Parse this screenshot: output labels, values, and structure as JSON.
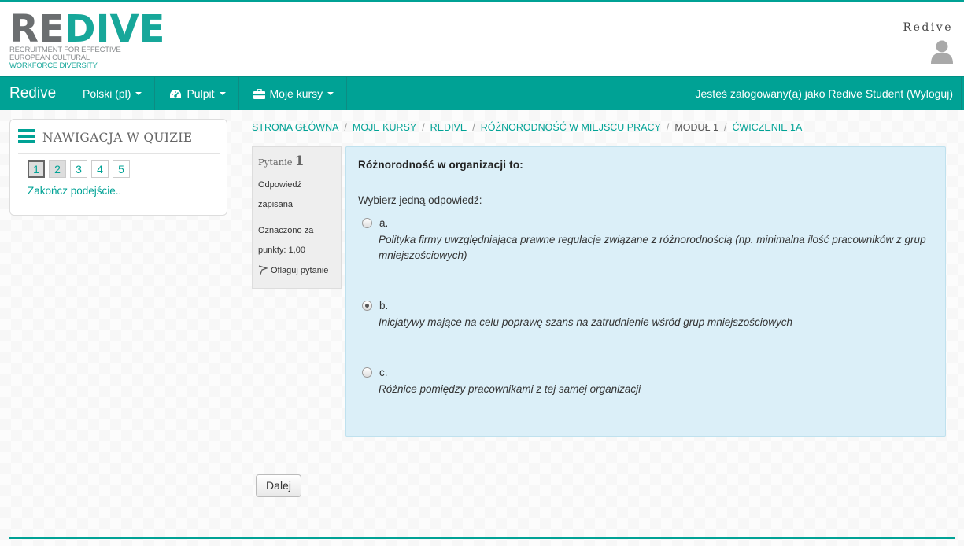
{
  "header": {
    "logo_re": "RE",
    "logo_dive": "DIVE",
    "logo_tag_1": "Recruitment for effective",
    "logo_tag_2": "European cultural",
    "logo_tag_3": "workforce diversity",
    "user_name": "Redive"
  },
  "navbar": {
    "brand": "Redive",
    "items": [
      {
        "label": "Polski (pl)",
        "icon": ""
      },
      {
        "label": "Pulpit",
        "icon": "dashboard-icon"
      },
      {
        "label": "Moje kursy",
        "icon": "briefcase-icon"
      }
    ],
    "login_info": "Jesteś zalogowany(a) jako Redive Student (Wyloguj)"
  },
  "quiz_nav": {
    "title": "NAWIGACJA W QUIZIE",
    "buttons": [
      "1",
      "2",
      "3",
      "4",
      "5"
    ],
    "finish_link": "Zakończ podejście.."
  },
  "breadcrumb": {
    "items": [
      "STRONA GŁÓWNA",
      "MOJE KURSY",
      "REDIVE",
      "RÓŻNORODNOŚĆ W MIEJSCU PRACY",
      "MODUŁ 1",
      "ĆWICZENIE 1A"
    ],
    "separator": "/"
  },
  "question_info": {
    "label": "Pytanie",
    "number": "1",
    "state_line1": "Odpowiedź",
    "state_line2": "zapisana",
    "grade_line1": "Oznaczono za",
    "grade_line2": "punkty: 1,00",
    "flag_label": "Oflaguj pytanie"
  },
  "question": {
    "text": "Różnorodność w organizacji to:",
    "prompt": "Wybierz jedną odpowiedź:",
    "answers": [
      {
        "letter": "a.",
        "text": "Polityka firmy uwzględniająca prawne regulacje związane z różnorodnością (np. minimalna ilość pracowników z grup mniejszościowych)",
        "selected": false
      },
      {
        "letter": "b.",
        "text": "Inicjatywy mające na celu poprawę szans na zatrudnienie wśród grup mniejszościowych",
        "selected": true
      },
      {
        "letter": "c.",
        "text": "Różnice pomiędzy pracownikami z tej samej organizacji",
        "selected": false
      }
    ]
  },
  "next_button": "Dalej",
  "colors": {
    "accent": "#00a295",
    "question_bg": "#dbeff8"
  }
}
